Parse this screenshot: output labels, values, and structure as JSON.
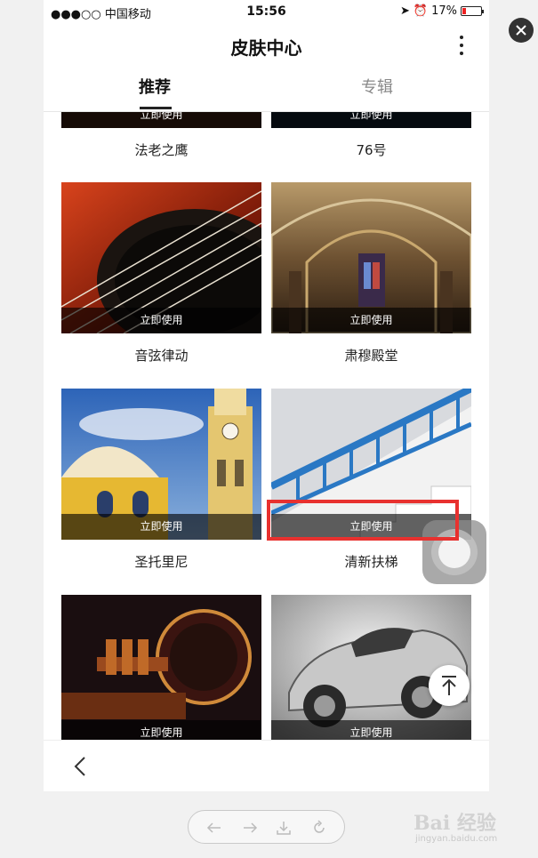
{
  "status_bar": {
    "carrier": "●●●○○ 中国移动",
    "time": "15:56",
    "battery": "17%"
  },
  "header": {
    "title": "皮肤中心"
  },
  "tabs": [
    {
      "label": "推荐",
      "active": true
    },
    {
      "label": "专辑",
      "active": false
    }
  ],
  "skins": [
    {
      "name": "法老之鹰",
      "action": "立即使用"
    },
    {
      "name": "76号",
      "action": "立即使用"
    },
    {
      "name": "音弦律动",
      "action": "立即使用"
    },
    {
      "name": "肃穆殿堂",
      "action": "立即使用"
    },
    {
      "name": "圣托里尼",
      "action": "立即使用"
    },
    {
      "name": "清新扶梯",
      "action": "立即使用"
    },
    {
      "name": "",
      "action": "立即使用"
    },
    {
      "name": "",
      "action": "立即使用"
    }
  ],
  "watermark": {
    "text": "Bai 经验",
    "url": "jingyan.baidu.com"
  },
  "colors": {
    "highlight": "#e8312f",
    "use_bar": "rgba(0,0,0,0.62)"
  }
}
